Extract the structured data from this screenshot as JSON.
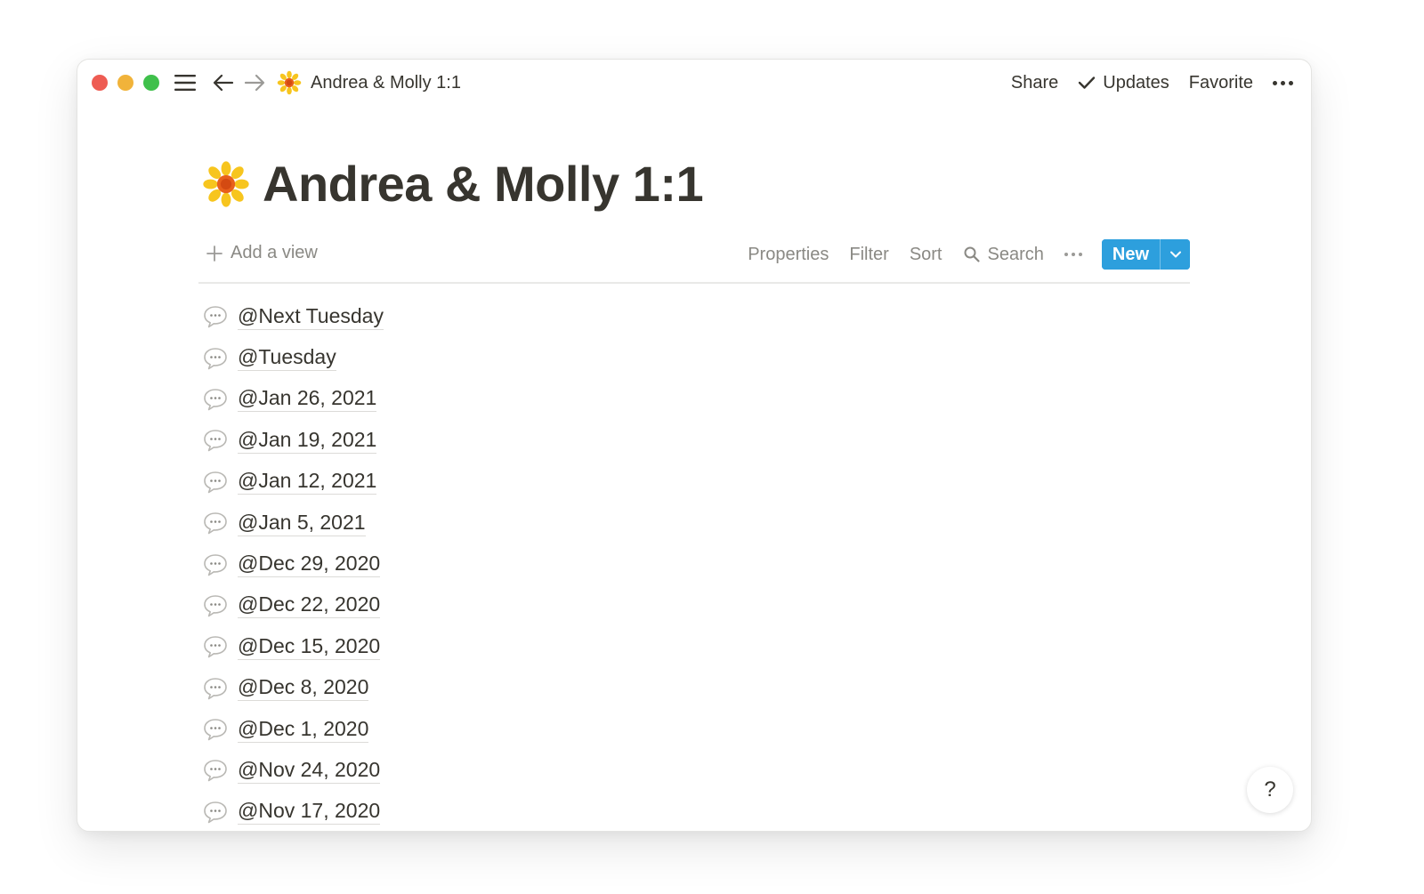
{
  "titlebar": {
    "breadcrumb_title": "Andrea & Molly 1:1",
    "share_label": "Share",
    "updates_label": "Updates",
    "favorite_label": "Favorite"
  },
  "page": {
    "title": "Andrea & Molly 1:1",
    "emoji": "sunflower-icon"
  },
  "toolbar": {
    "add_view_label": "Add a view",
    "properties_label": "Properties",
    "filter_label": "Filter",
    "sort_label": "Sort",
    "search_label": "Search",
    "new_label": "New"
  },
  "entries": [
    {
      "label": "@Next Tuesday"
    },
    {
      "label": "@Tuesday"
    },
    {
      "label": "@Jan 26, 2021"
    },
    {
      "label": "@Jan 19, 2021"
    },
    {
      "label": "@Jan 12, 2021"
    },
    {
      "label": "@Jan 5, 2021"
    },
    {
      "label": "@Dec 29, 2020"
    },
    {
      "label": "@Dec 22, 2020"
    },
    {
      "label": "@Dec 15, 2020"
    },
    {
      "label": "@Dec 8, 2020"
    },
    {
      "label": "@Dec 1, 2020"
    },
    {
      "label": "@Nov 24, 2020"
    },
    {
      "label": "@Nov 17, 2020"
    }
  ],
  "help": {
    "label": "?"
  },
  "colors": {
    "accent": "#2d9fdd",
    "traffic_red": "#ee5c53",
    "traffic_yellow": "#f1b33a",
    "traffic_green": "#3fc04b"
  }
}
